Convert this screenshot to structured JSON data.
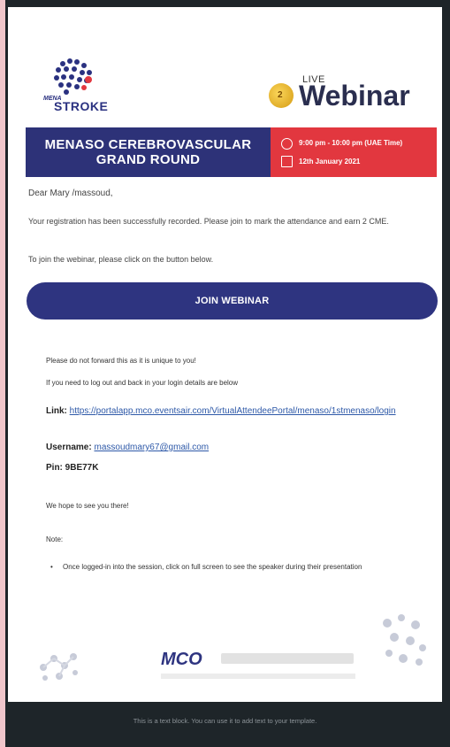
{
  "header": {
    "brand_small": "MENA",
    "brand_main": "STROKE",
    "live_label": "LIVE",
    "webinar_label": "Webinar",
    "badge_number": "2"
  },
  "banner": {
    "title_line1": "MENASO CEREBROVASCULAR",
    "title_line2": "GRAND ROUND",
    "time": "9:00 pm - 10:00 pm (UAE Time)",
    "date": "12th January 2021"
  },
  "body": {
    "greeting": "Dear Mary /massoud,",
    "registration_msg": "Your registration has been successfully recorded. Please join to mark the attendance and earn 2 CME.",
    "join_instructions": "To join the webinar, please click on the button below.",
    "join_button": "JOIN WEBINAR",
    "forward_note": "Please do not forward this as it is unique to you!",
    "login_note": "If you need to log out and back in your login details are below",
    "link_label": "Link:",
    "link_value": "https://portalapp.mco.eventsair.com/VirtualAttendeePortal/menaso/1stmenaso/login",
    "username_label": "Username:",
    "username_value": "massoudmary67@gmail.com",
    "pin_label": "Pin:",
    "pin_value": "9BE77K",
    "hope": "We hope to see you there!",
    "note_label": "Note:",
    "note_item": "Once logged-in into the session, click on full screen to see the speaker during their presentation"
  },
  "footer": {
    "mco_label": "MCO",
    "dark_text": "This is a text block. You can use it to add text to your template."
  },
  "colors": {
    "navy": "#2d3278",
    "red": "#e2373f",
    "link": "#2e59a8"
  }
}
